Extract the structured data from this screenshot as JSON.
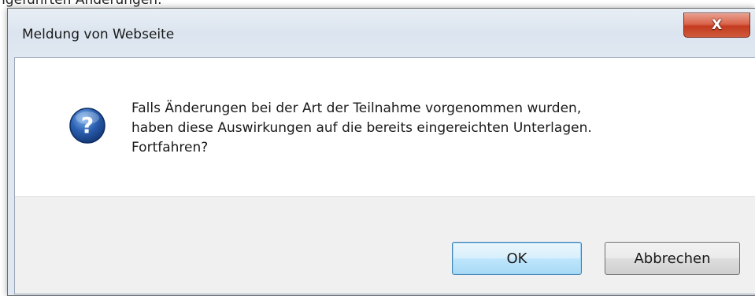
{
  "background_text": "ngeführten Änderungen.",
  "dialog": {
    "title": "Meldung von Webseite",
    "close_label": "X",
    "icon": "question-icon",
    "message_lines": [
      "Falls Änderungen bei der Art der Teilnahme vorgenommen wurden,",
      "haben diese Auswirkungen auf die bereits eingereichten Unterlagen.",
      "Fortfahren?"
    ],
    "buttons": {
      "ok": "OK",
      "cancel": "Abbrechen"
    }
  },
  "colors": {
    "close_button": "#c43b1f",
    "question_icon": "#2a5fb0",
    "default_button_border": "#3c7fb1"
  }
}
